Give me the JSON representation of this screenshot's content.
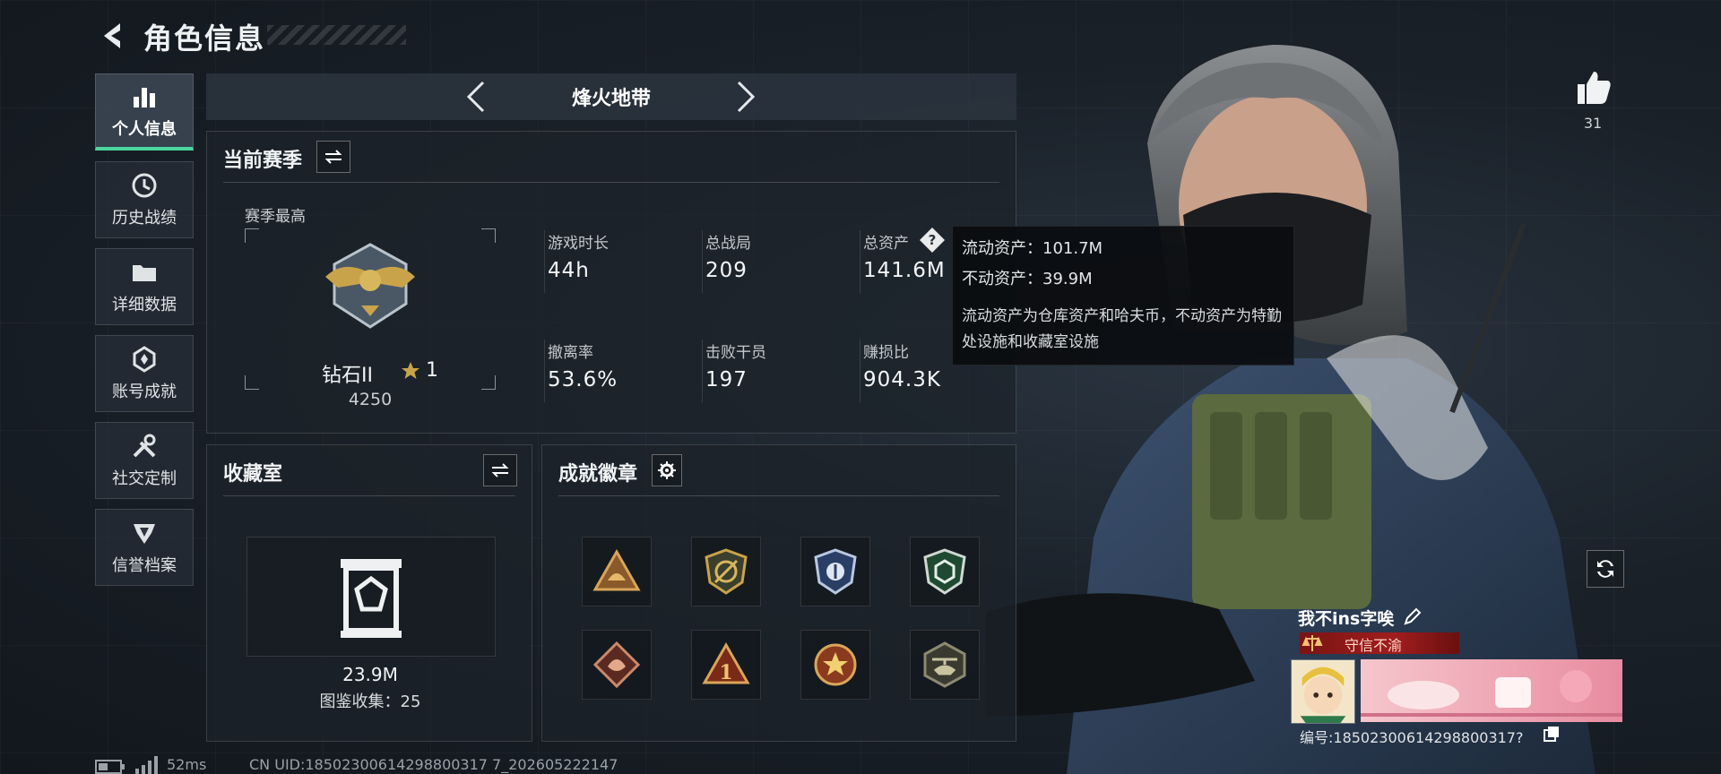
{
  "header": {
    "title": "角色信息"
  },
  "sidebar": {
    "items": [
      {
        "label": "个人信息",
        "icon": "bar-chart-icon",
        "active": true
      },
      {
        "label": "历史战绩",
        "icon": "history-icon",
        "active": false
      },
      {
        "label": "详细数据",
        "icon": "folder-icon",
        "active": false
      },
      {
        "label": "账号成就",
        "icon": "achievement-icon",
        "active": false
      },
      {
        "label": "社交定制",
        "icon": "tools-icon",
        "active": false
      },
      {
        "label": "信誉档案",
        "icon": "credit-icon",
        "active": false
      }
    ]
  },
  "mode": {
    "name": "烽火地带"
  },
  "season": {
    "title": "当前赛季",
    "best_label": "赛季最高",
    "rank_name": "钻石II",
    "rank_stars": "1",
    "rank_score": "4250",
    "stats": [
      {
        "label": "游戏时长",
        "value": "44h"
      },
      {
        "label": "总战局",
        "value": "209"
      },
      {
        "label": "总资产",
        "value": "141.6M"
      },
      {
        "label": "撤离率",
        "value": "53.6%"
      },
      {
        "label": "击败干员",
        "value": "197"
      },
      {
        "label": "赚损比",
        "value": "904.3K"
      }
    ]
  },
  "tooltip": {
    "liquid": "流动资产：101.7M",
    "fixed": "不动资产：39.9M",
    "desc": "流动资产为仓库资产和哈夫币，不动资产为特勤处设施和收藏室设施"
  },
  "collection": {
    "title": "收藏室",
    "value": "23.9M",
    "catalog": "图鉴收集：25"
  },
  "badges": {
    "title": "成就徽章",
    "items": [
      "triangle-helmet-badge",
      "shield-gold-badge",
      "shield-blue-badge",
      "shield-green-badge",
      "dragon-badge",
      "triangle-one-badge",
      "star-medal-badge",
      "helicopter-badge"
    ]
  },
  "player": {
    "likes": "31",
    "name": "我不ins字唉",
    "title": "守信不渝",
    "id": "编号:18502300614298800317?"
  },
  "footer": {
    "ping": "52ms",
    "uid": "CN UID:18502300614298800317 7_202605222147"
  },
  "colors": {
    "accent": "#4bd6a0",
    "gold": "#c9a34a",
    "title_red": "#a11d1d"
  }
}
